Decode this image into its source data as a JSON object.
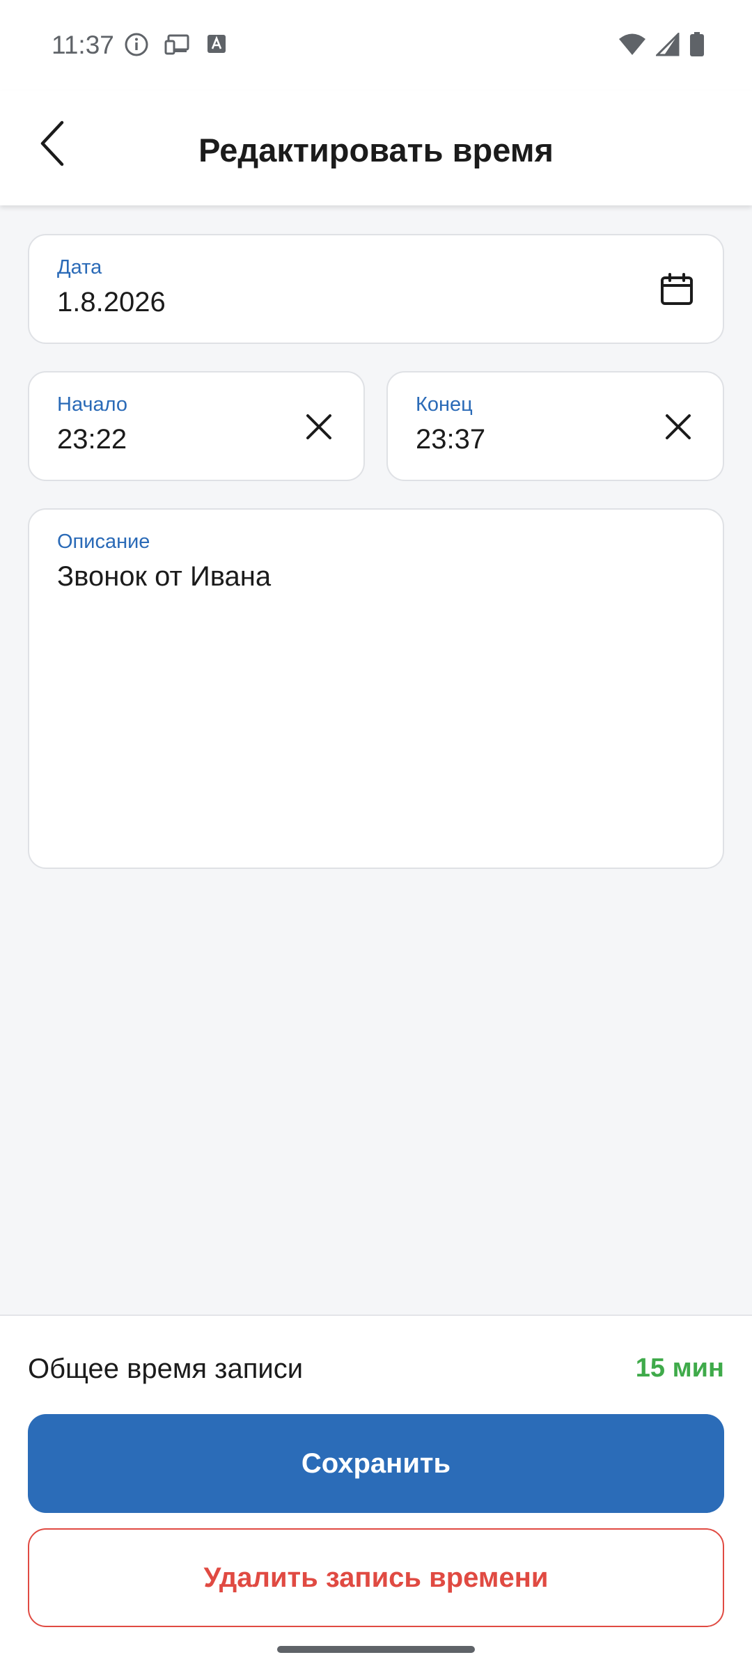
{
  "status_bar": {
    "time": "11:37",
    "icons_left": [
      "info-icon",
      "cast-devices-icon",
      "keyboard-a-icon"
    ],
    "icons_right": [
      "wifi-icon",
      "cellular-signal-icon",
      "battery-icon"
    ]
  },
  "app_bar": {
    "title": "Редактировать время",
    "back_icon": "back-chevron-icon"
  },
  "form": {
    "date": {
      "label": "Дата",
      "value": "1.8.2026",
      "icon": "calendar-icon"
    },
    "start": {
      "label": "Начало",
      "value": "23:22",
      "icon": "clear-x-icon"
    },
    "end": {
      "label": "Конец",
      "value": "23:37",
      "icon": "clear-x-icon"
    },
    "description": {
      "label": "Описание",
      "value": "Звонок от Ивана"
    }
  },
  "summary": {
    "total_label": "Общее время записи",
    "total_value": "15 мин"
  },
  "actions": {
    "save_label": "Сохранить",
    "delete_label": "Удалить запись времени"
  },
  "colors": {
    "accent": "#2b6cb8",
    "label_blue": "#2a6ab7",
    "total_green": "#3faa4a",
    "danger": "#e04a42",
    "background": "#f5f6f8"
  }
}
